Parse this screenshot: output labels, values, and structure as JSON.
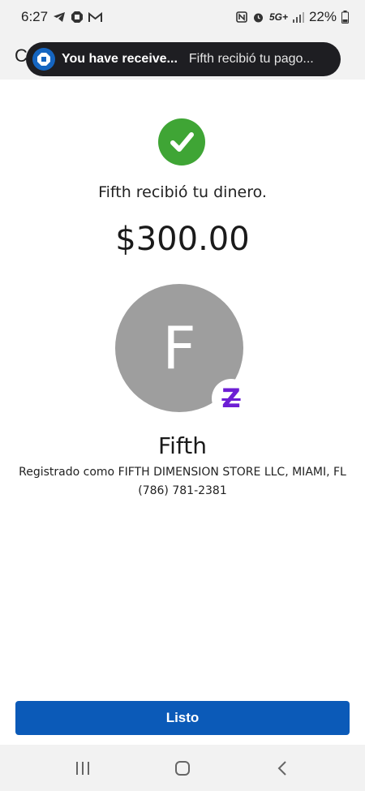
{
  "status_bar": {
    "time": "6:27",
    "network": "5G+",
    "battery": "22%",
    "icons": [
      "telegram-icon",
      "chase-octagon-icon",
      "gmail-icon",
      "nfc-icon",
      "alarm-icon",
      "signal-icon",
      "battery-icon"
    ]
  },
  "header": {
    "back_letter": "C"
  },
  "toast": {
    "icon": "chase-logo-icon",
    "title": "You have receive...",
    "body": "Fifth recibió tu pago..."
  },
  "confirmation": {
    "check_icon": "checkmark-icon",
    "message": "Fifth recibió tu dinero.",
    "amount": "$300.00"
  },
  "recipient": {
    "avatar_initial": "F",
    "badge_icon": "zelle-icon",
    "badge_symbol": "Z",
    "name": "Fifth",
    "registered": "Registrado como FIFTH DIMENSION STORE LLC, MIAMI, FL",
    "phone": "(786) 781-2381"
  },
  "actions": {
    "done_label": "Listo"
  },
  "nav": {
    "items": [
      "recents-icon",
      "home-icon",
      "back-icon"
    ]
  },
  "colors": {
    "success": "#3fa535",
    "primary": "#0b5ab8",
    "zelle": "#6d1ed4",
    "avatar": "#9e9e9e"
  }
}
